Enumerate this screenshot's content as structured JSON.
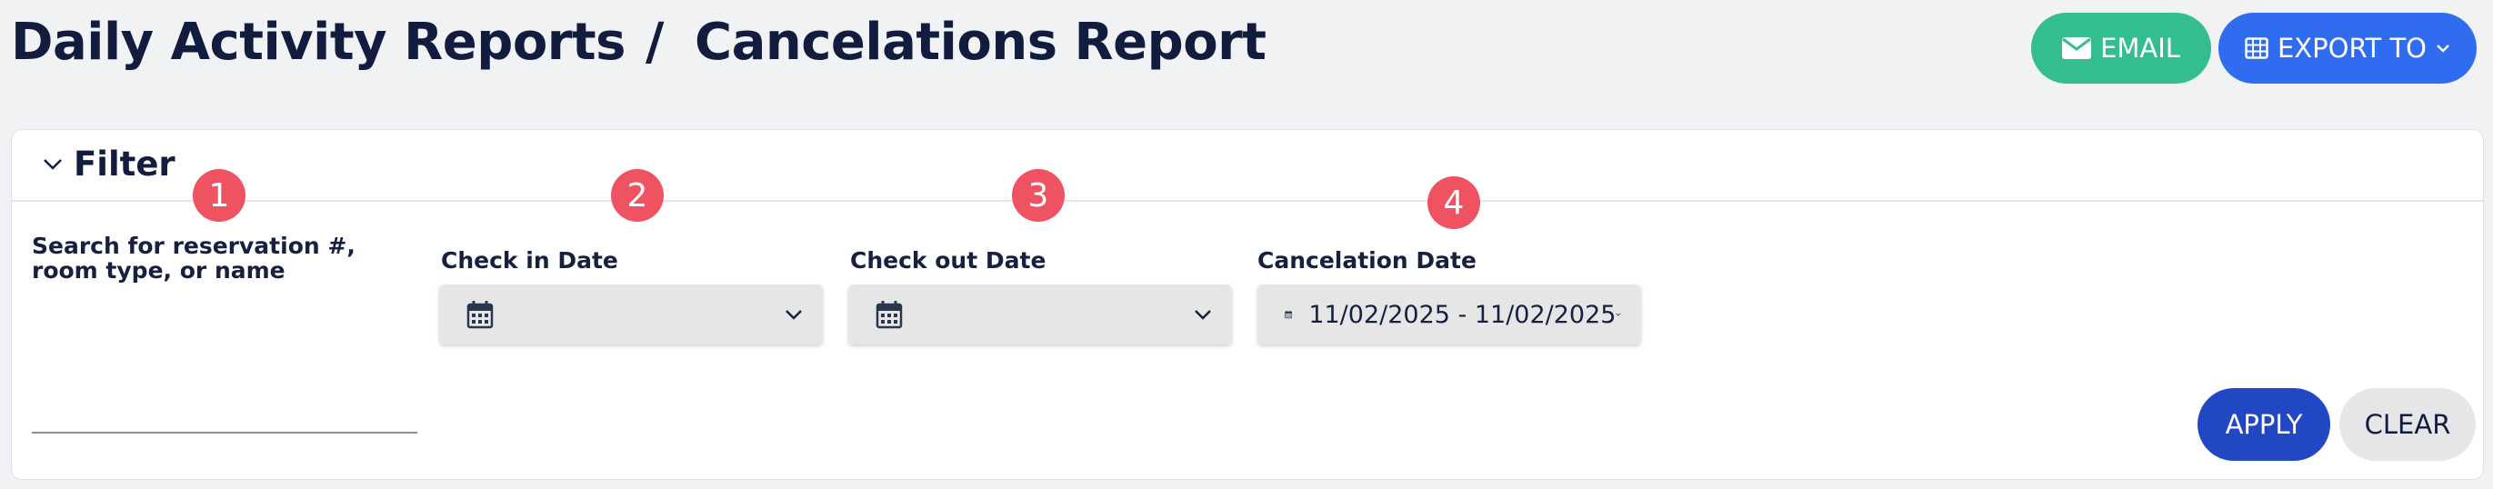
{
  "header": {
    "breadcrumb_parent": "Daily Activity Reports",
    "breadcrumb_separator": "/",
    "breadcrumb_current": "Cancelations Report",
    "email_label": "EMAIL",
    "export_label": "EXPORT TO",
    "email_icon": "envelope-icon",
    "export_icon": "table-icon"
  },
  "filter": {
    "title": "Filter",
    "markers": [
      "1",
      "2",
      "3",
      "4"
    ],
    "search": {
      "label": "Search for reservation #, room type, or name",
      "value": "",
      "placeholder": ""
    },
    "check_in": {
      "label": "Check in Date",
      "value": ""
    },
    "check_out": {
      "label": "Check out Date",
      "value": ""
    },
    "cancelation": {
      "label": "Cancelation Date",
      "value": "11/02/2025 - 11/02/2025"
    },
    "apply_label": "APPLY",
    "clear_label": "CLEAR"
  },
  "colors": {
    "email": "#34bd91",
    "export": "#2f6cf0",
    "apply": "#2147c5",
    "marker": "#ef5362"
  }
}
